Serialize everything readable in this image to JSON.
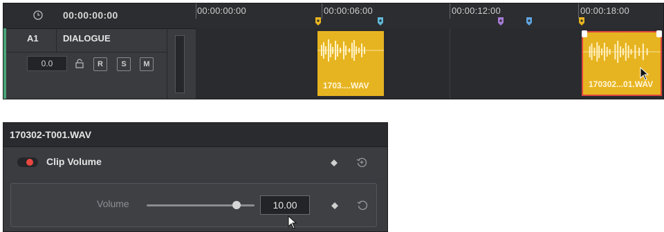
{
  "timeline": {
    "current_timecode": "00:00:00:00",
    "track": {
      "id": "A1",
      "name": "DIALOGUE",
      "volume": "0.0",
      "buttons": [
        "R",
        "S",
        "M"
      ]
    },
    "ruler_labels": [
      "00:00:00:00",
      "00:00:06:00",
      "00:00:12:00",
      "00:00:18:00"
    ],
    "markers": [
      {
        "color": "#e7b421"
      },
      {
        "color": "#5fb7d8"
      },
      {
        "color": "#a77bd6"
      },
      {
        "color": "#5fa4e0"
      },
      {
        "color": "#e7b421"
      }
    ],
    "clips": [
      {
        "name": "1703....WAV",
        "selected": false
      },
      {
        "name": "170302...01.WAV",
        "selected": true
      }
    ]
  },
  "inspector": {
    "title": "170302-T001.WAV",
    "section_title": "Clip Volume",
    "section_enabled": true,
    "volume_label": "Volume",
    "volume_value": "10.00"
  },
  "colors": {
    "clip": "#e7b421",
    "selection": "#e0463d",
    "toggle_on": "#e8473f",
    "track_color": "#4aa37a"
  }
}
